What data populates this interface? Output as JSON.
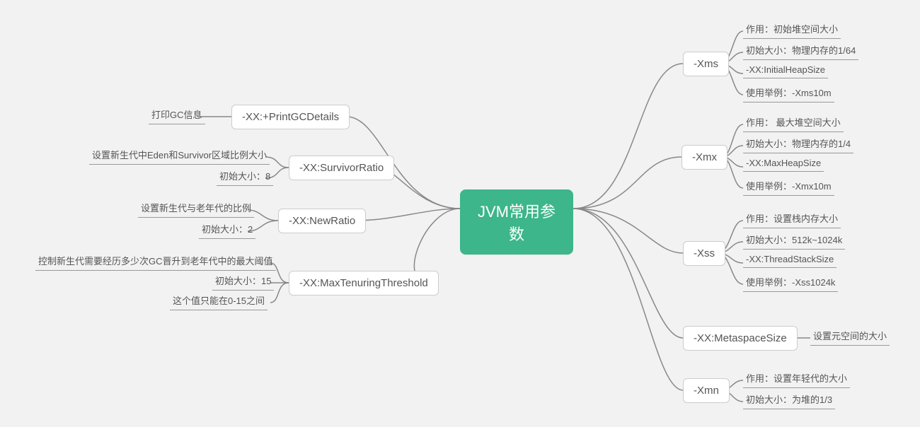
{
  "root": {
    "label": "JVM常用参数"
  },
  "left": {
    "printgc": {
      "label": "-XX:+PrintGCDetails",
      "items": [
        "打印GC信息"
      ]
    },
    "survivor": {
      "label": "-XX:SurvivorRatio",
      "items": [
        "设置新生代中Eden和Survivor区域比例大小",
        "初始大小：8"
      ]
    },
    "newratio": {
      "label": "-XX:NewRatio",
      "items": [
        "设置新生代与老年代的比例",
        "初始大小：2"
      ]
    },
    "maxtenuring": {
      "label": "-XX:MaxTenuringThreshold",
      "items": [
        "控制新生代需要经历多少次GC晋升到老年代中的最大阈值",
        "初始大小：15",
        "这个值只能在0-15之间"
      ]
    }
  },
  "right": {
    "xms": {
      "label": "-Xms",
      "items": [
        "作用：初始堆空间大小",
        "初始大小：物理内存的1/64",
        "-XX:InitialHeapSize",
        "使用举例：-Xms10m"
      ]
    },
    "xmx": {
      "label": "-Xmx",
      "items": [
        "作用： 最大堆空间大小",
        "初始大小：物理内存的1/4",
        "-XX:MaxHeapSize",
        "使用举例：-Xmx10m"
      ]
    },
    "xss": {
      "label": "-Xss",
      "items": [
        "作用：设置栈内存大小",
        "初始大小：512k~1024k",
        "-XX:ThreadStackSize",
        "使用举例：-Xss1024k"
      ]
    },
    "metaspace": {
      "label": "-XX:MetaspaceSize",
      "items": [
        "设置元空间的大小"
      ]
    },
    "xmn": {
      "label": "-Xmn",
      "items": [
        "作用：设置年轻代的大小",
        "初始大小：为堆的1/3"
      ]
    }
  }
}
